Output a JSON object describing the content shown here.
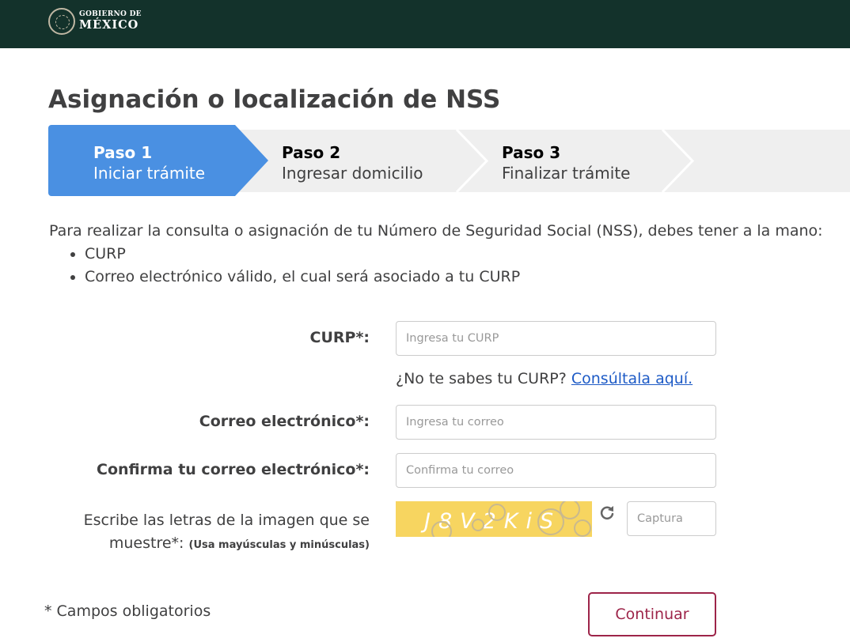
{
  "header": {
    "logo_line1": "GOBIERNO DE",
    "logo_line2": "MÉXICO"
  },
  "page": {
    "title": "Asignación o localización de NSS"
  },
  "steps": [
    {
      "number": "Paso 1",
      "name": "Iniciar trámite",
      "active": true
    },
    {
      "number": "Paso 2",
      "name": "Ingresar domicilio",
      "active": false
    },
    {
      "number": "Paso 3",
      "name": "Finalizar trámite",
      "active": false
    }
  ],
  "intro": {
    "text": "Para realizar la consulta o asignación de tu Número de Seguridad Social (NSS), debes tener a la mano:",
    "items": [
      "CURP",
      "Correo electrónico válido, el cual será asociado a tu CURP"
    ]
  },
  "form": {
    "curp_label": "CURP*:",
    "curp_placeholder": "Ingresa tu CURP",
    "curp_help": "¿No te sabes tu CURP?",
    "curp_help_link": "Consúltala aquí.",
    "email_label": "Correo electrónico*:",
    "email_placeholder": "Ingresa tu correo",
    "confirm_label": "Confirma tu correo electrónico*:",
    "confirm_placeholder": "Confirma tu correo",
    "captcha_label_line1": "Escribe las letras de la imagen que se",
    "captcha_label_line2": "muestre*:",
    "captcha_label_note": "(Usa mayúsculas y minúsculas)",
    "captcha_text": "J8V2KiS",
    "captcha_placeholder": "Captura"
  },
  "footer": {
    "required_note": "* Campos obligatorios",
    "continue_label": "Continuar"
  },
  "colors": {
    "header_bg": "#13322b",
    "active_step": "#4a90e2",
    "button_border": "#9d2449",
    "link": "#1e5bc6",
    "captcha_bg": "#f7d560"
  },
  "icons": {
    "seal": "mexico-seal-icon",
    "refresh": "refresh-icon",
    "chevron": "chevron-right-icon"
  }
}
